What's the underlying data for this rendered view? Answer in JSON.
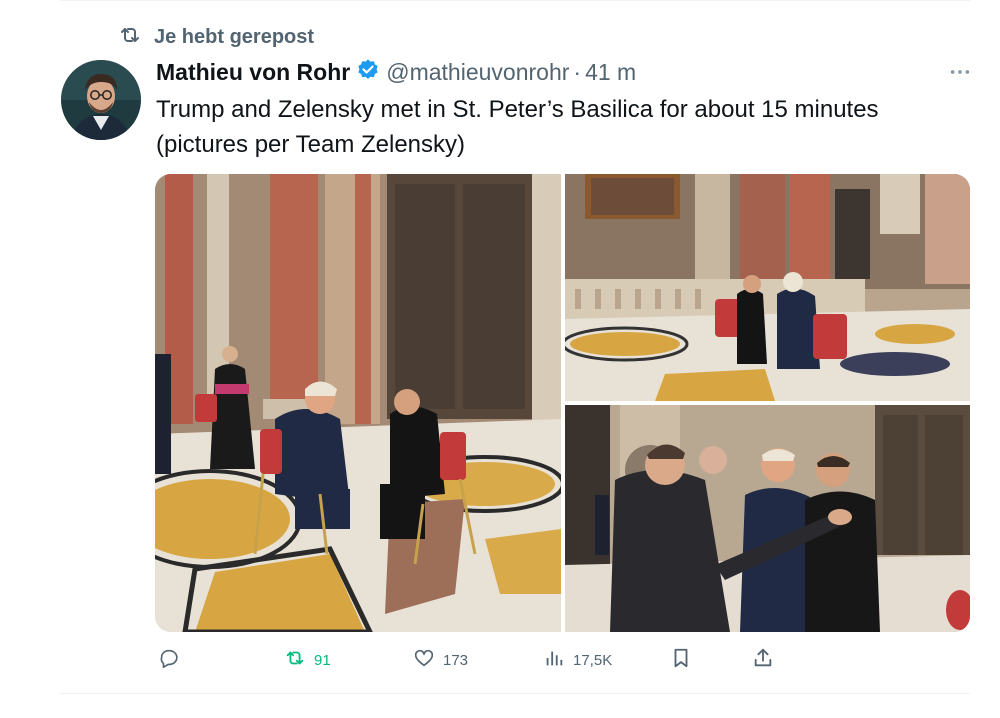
{
  "repost_banner": {
    "icon": "repost-icon",
    "text": "Je hebt gerepost"
  },
  "author": {
    "name": "Mathieu von Rohr",
    "verified_icon": "verified-badge-icon",
    "handle": "@mathieuvonrohr",
    "separator": "·",
    "time": "41 m"
  },
  "more_icon": "more-options-icon",
  "tweet_text": "Trump and Zelensky met in St. Peter’s Basilica for about 15 minutes (pictures per Team Zelensky)",
  "media": [
    {
      "name": "photo-trump-zelensky-seated"
    },
    {
      "name": "photo-seated-overview"
    },
    {
      "name": "photo-macron-trump-zelensky-standing"
    }
  ],
  "actions": {
    "reply": {
      "icon": "reply-icon",
      "count": ""
    },
    "repost": {
      "icon": "repost-icon",
      "count": "91",
      "color": "#00ba7c"
    },
    "like": {
      "icon": "heart-icon",
      "count": "173"
    },
    "views": {
      "icon": "views-chart-icon",
      "count": "17,5K"
    },
    "bookmark": {
      "icon": "bookmark-icon"
    },
    "share": {
      "icon": "share-icon"
    }
  },
  "colors": {
    "secondary_text": "#536471",
    "verified_blue": "#1d9bf0",
    "repost_green": "#00ba7c"
  }
}
